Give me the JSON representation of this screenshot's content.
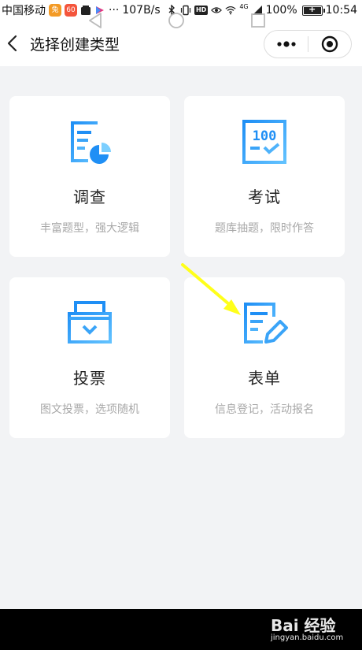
{
  "status_bar": {
    "carrier": "中国移动",
    "speed": "107B/s",
    "signal_label": "4G",
    "hd_label": "HD",
    "battery": "100%",
    "time": "10:54",
    "app_badge_1": "兔",
    "app_badge_2": "60",
    "dots": "···"
  },
  "nav": {
    "title": "选择创建类型"
  },
  "cards": [
    {
      "title": "调查",
      "desc": "丰富题型，强大逻辑",
      "icon": "survey-chart-icon"
    },
    {
      "title": "考试",
      "desc": "题库抽题，限时作答",
      "icon": "exam-score-icon",
      "icon_text": "100"
    },
    {
      "title": "投票",
      "desc": "图文投票，选项随机",
      "icon": "vote-box-icon"
    },
    {
      "title": "表单",
      "desc": "信息登记，活动报名",
      "icon": "form-edit-icon"
    }
  ],
  "watermark": {
    "main": "Bai 经验",
    "sub": "jingyan.baidu.com"
  },
  "colors": {
    "accent_dark": "#1f8ff5",
    "accent_light": "#62c2ff",
    "page_bg": "#f2f3f5",
    "annotation_arrow": "#ffff1a"
  }
}
